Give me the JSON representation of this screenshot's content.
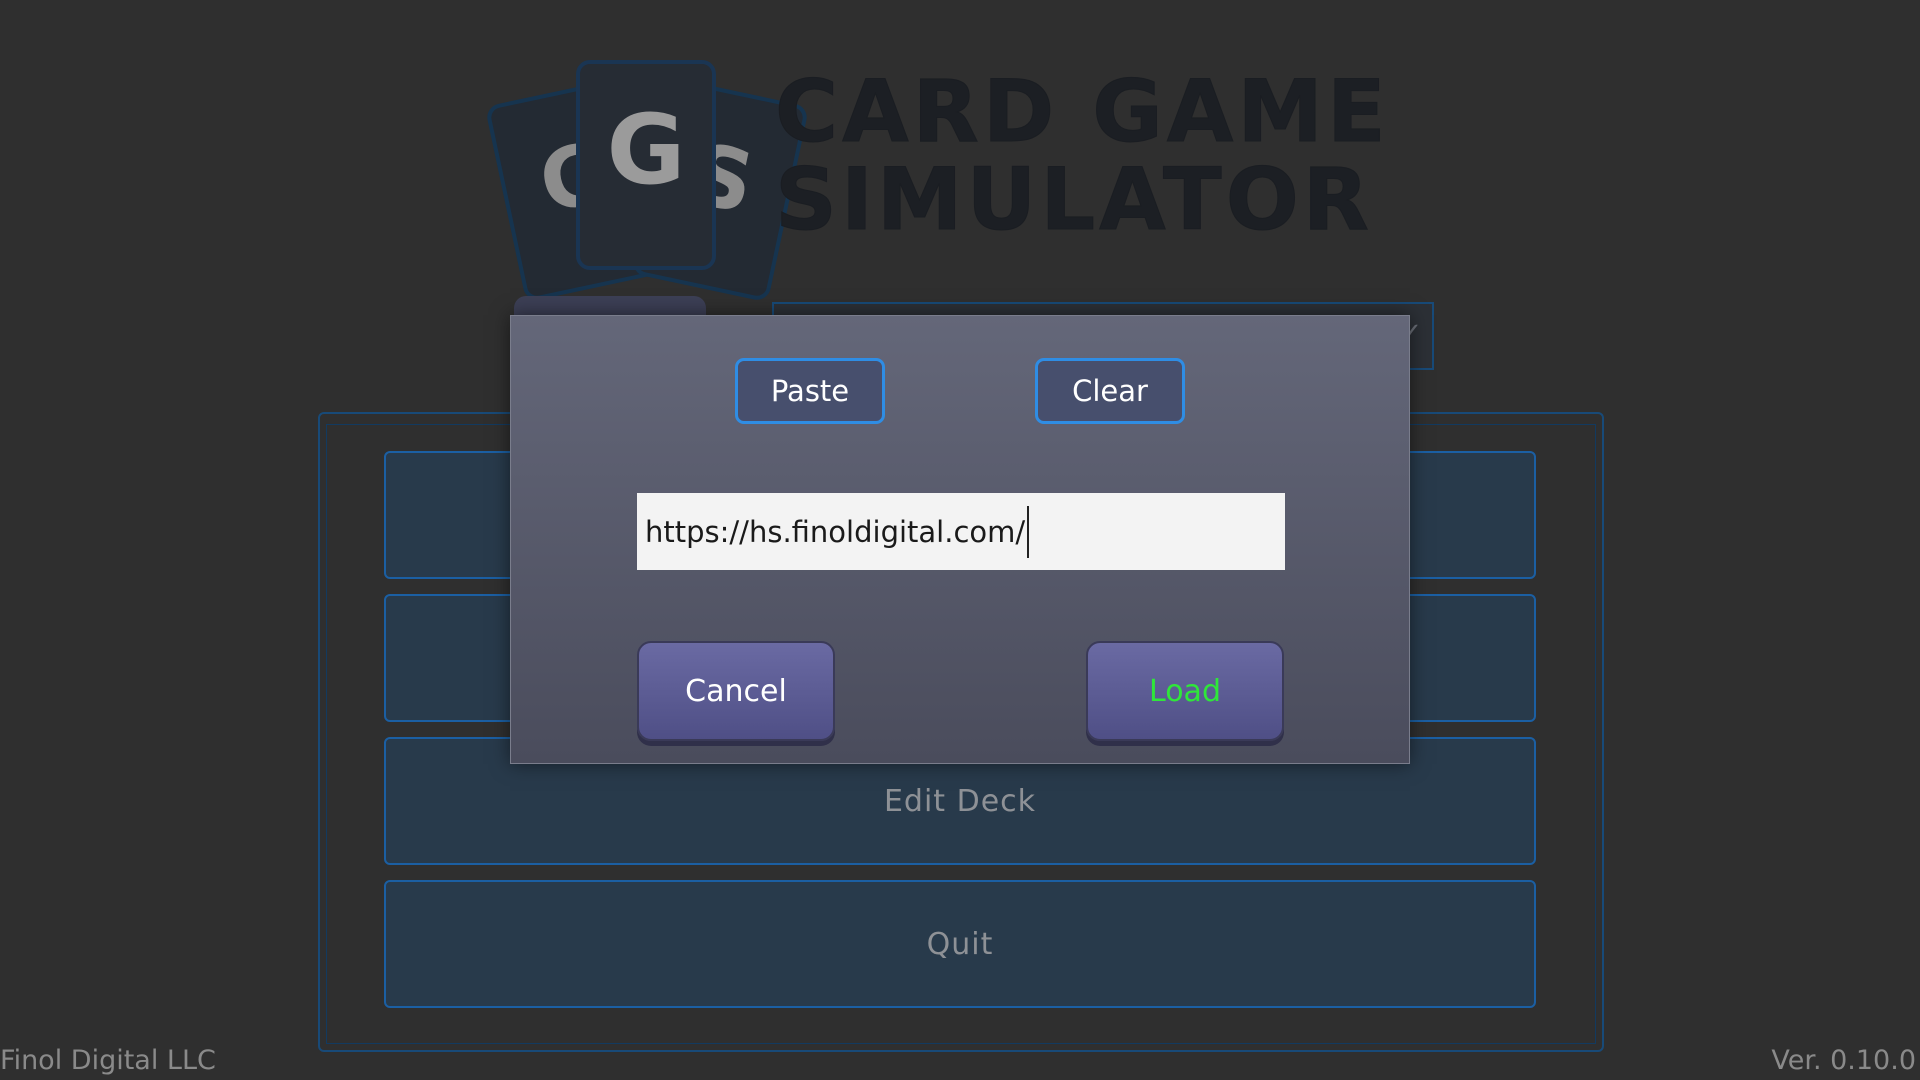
{
  "logo": {
    "letters": [
      "C",
      "G",
      "S"
    ],
    "title_line1": "CARD GAME",
    "title_line2": "SIMULATOR"
  },
  "menu": {
    "items": [
      "",
      "",
      "Edit Deck",
      "Quit"
    ]
  },
  "dialog": {
    "paste_label": "Paste",
    "clear_label": "Clear",
    "url_value": "https://hs.finoldigital.com/",
    "cancel_label": "Cancel",
    "load_label": "Load"
  },
  "footer": {
    "company": "Finol Digital LLC",
    "version": "Ver. 0.10.0"
  },
  "colors": {
    "accent_blue": "#2f8de4",
    "load_green": "#2fe63a",
    "menu_border": "#1b5fa3"
  }
}
